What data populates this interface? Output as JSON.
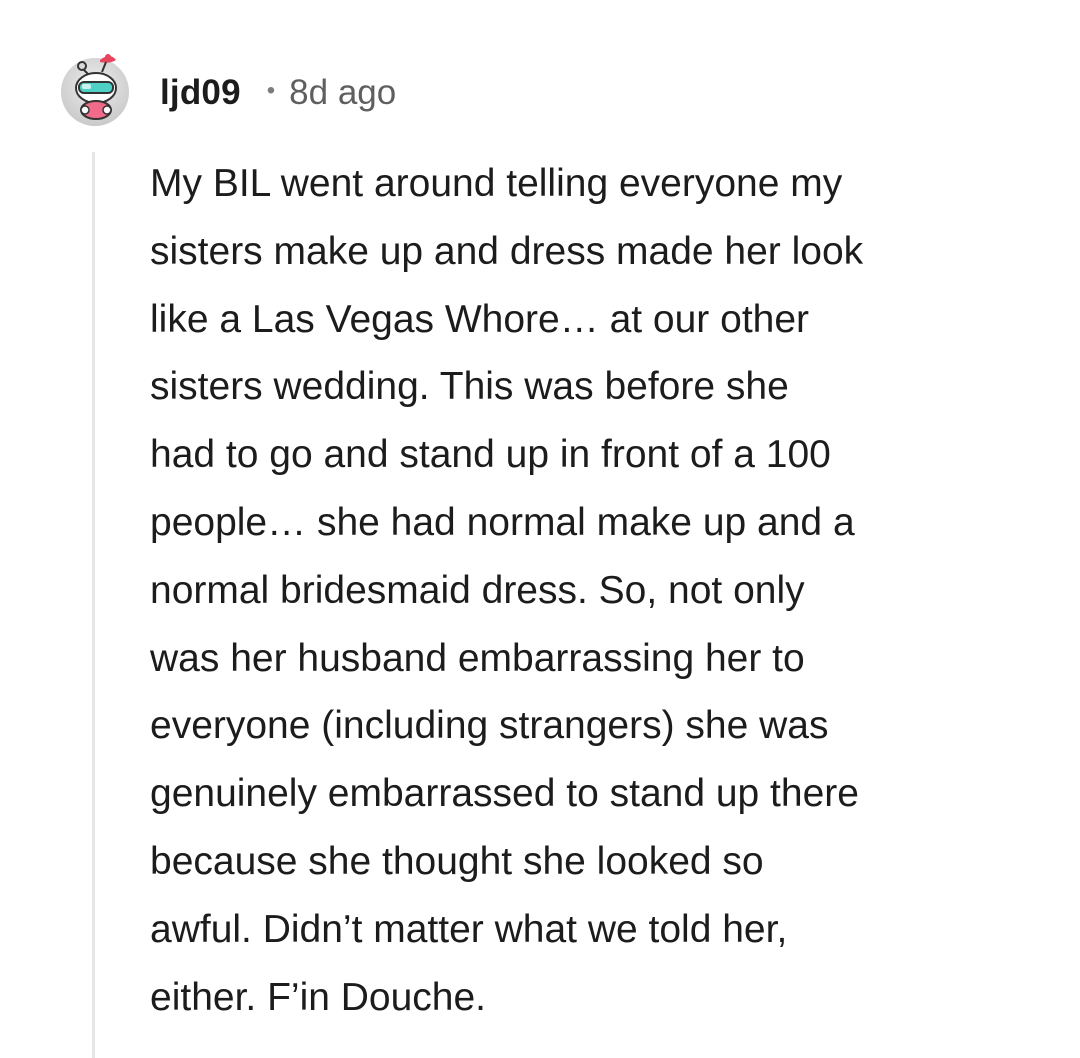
{
  "comment": {
    "username": "ljd09",
    "separator": "•",
    "age": "8d ago",
    "avatar_icon": "snoo-avatar-icon",
    "lines": [
      "My BIL went around telling everyone my",
      "sisters make up and dress made her look",
      "like a Las Vegas Whore… at our other",
      "sisters wedding. This was before she",
      "had to go and stand up in front of a 100",
      "people… she had normal make up and a",
      "normal bridesmaid dress. So, not only",
      "was her husband embarrassing her to",
      "everyone (including strangers) she was",
      "genuinely embarrassed to stand up there",
      "because she thought she looked so",
      "awful. Didn’t matter what we told her,",
      "either. F’in Douche."
    ]
  },
  "colors": {
    "text": "#1c1c1c",
    "meta": "#5f5f5f",
    "thread_line": "#e6e6e6",
    "avatar_bg": "#dcdcdc",
    "accent_pink": "#f06a8a",
    "accent_teal": "#4fd1c5"
  }
}
